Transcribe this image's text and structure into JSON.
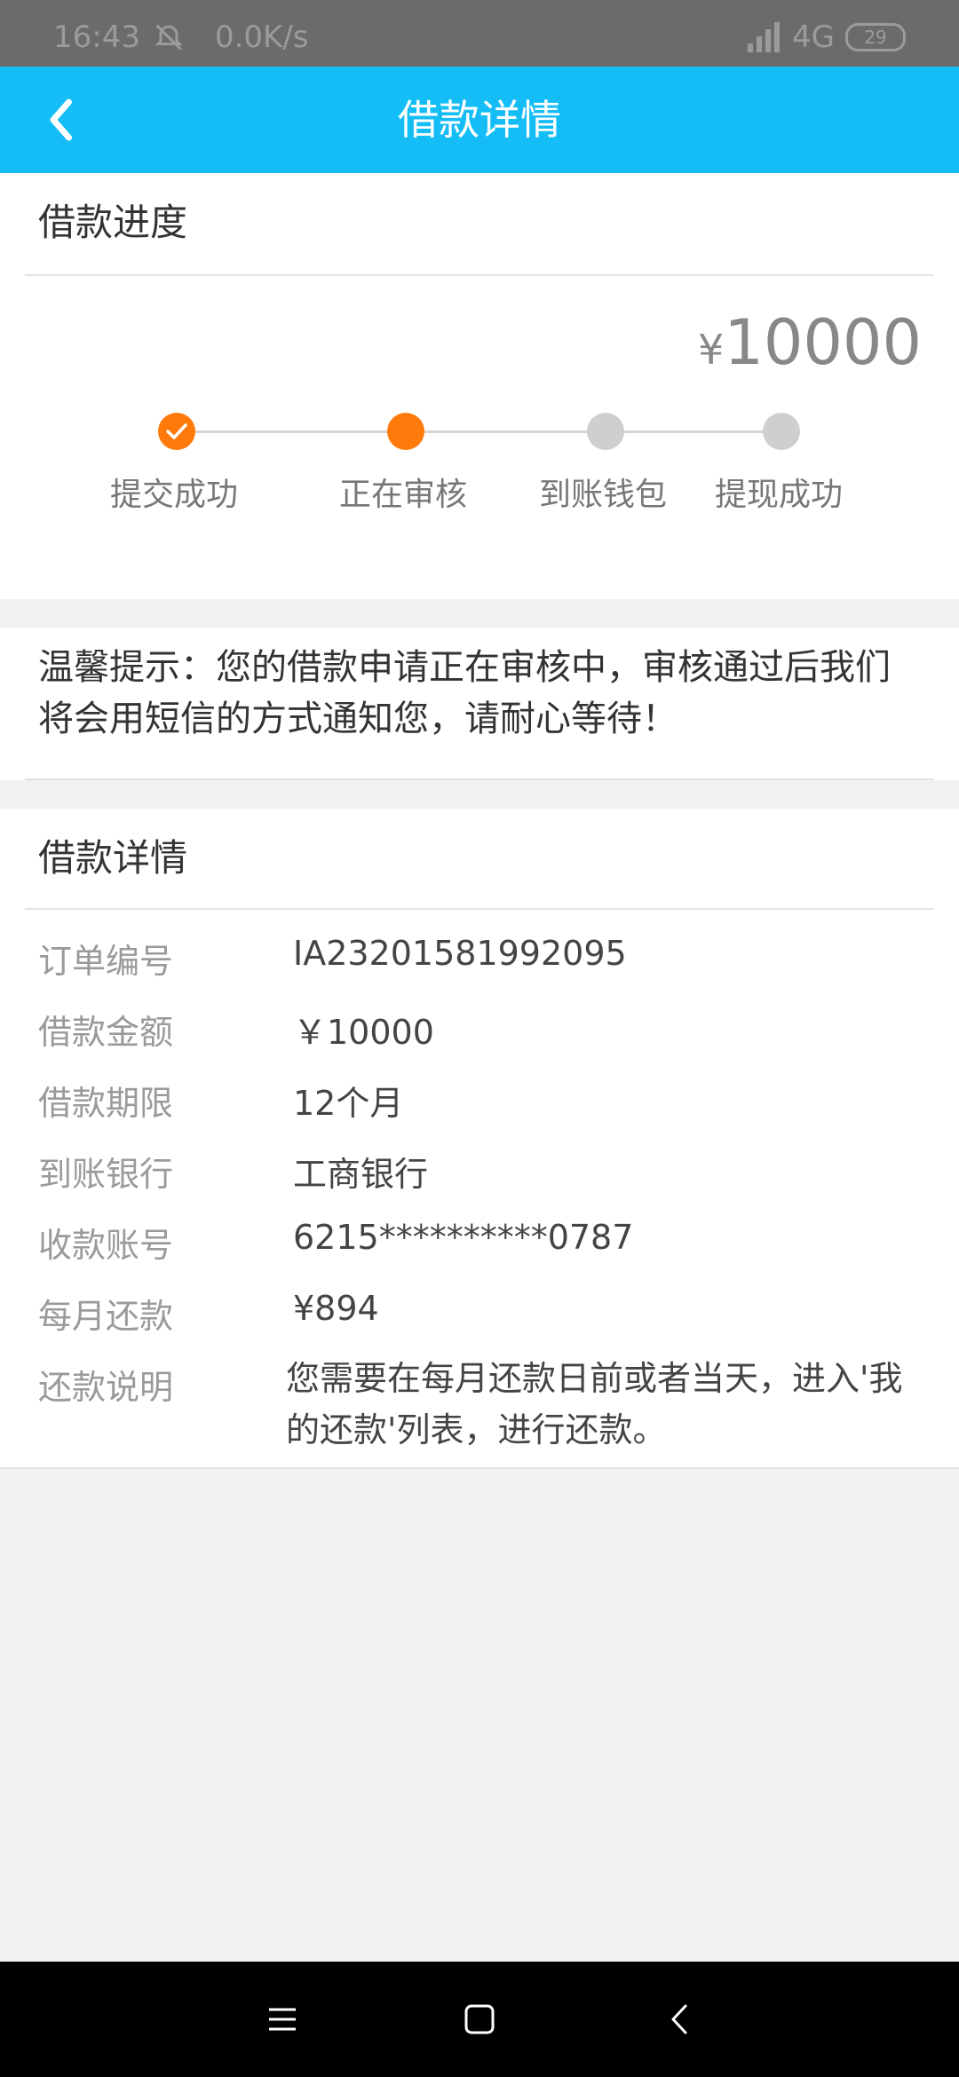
{
  "status_bar": {
    "time": "16:43",
    "net_speed": "0.0K/s",
    "network": "4G",
    "battery": "29",
    "icons": [
      "alarm-off-icon",
      "signal-icon",
      "battery-icon"
    ]
  },
  "app_bar": {
    "title": "借款详情",
    "back_icon": "chevron-left-icon",
    "color": "#14bdf5"
  },
  "progress": {
    "section_title": "借款进度",
    "amount_symbol": "¥",
    "amount": "10000",
    "steps": [
      {
        "label": "提交成功",
        "state": "done"
      },
      {
        "label": "正在审核",
        "state": "current"
      },
      {
        "label": "到账钱包",
        "state": "pending"
      },
      {
        "label": "提现成功",
        "state": "pending"
      }
    ],
    "accent": "#ff7a0a"
  },
  "notice": {
    "text": "温馨提示：您的借款申请正在审核中，审核通过后我们将会用短信的方式通知您，请耐心等待！"
  },
  "details": {
    "section_title": "借款详情",
    "rows": [
      {
        "key": "订单编号",
        "value": "IA23201581992095"
      },
      {
        "key": "借款金额",
        "value": "￥10000"
      },
      {
        "key": "借款期限",
        "value": "12个月"
      },
      {
        "key": "到账银行",
        "value": "工商银行"
      },
      {
        "key": "收款账号",
        "value": "6215**********0787"
      },
      {
        "key": "每月还款",
        "value": "¥894"
      },
      {
        "key": "还款说明",
        "value": "您需要在每月还款日前或者当天，进入'我的还款'列表，进行还款。"
      }
    ]
  },
  "nav_bar": {
    "icons": [
      "menu-icon",
      "home-icon",
      "back-icon"
    ]
  }
}
